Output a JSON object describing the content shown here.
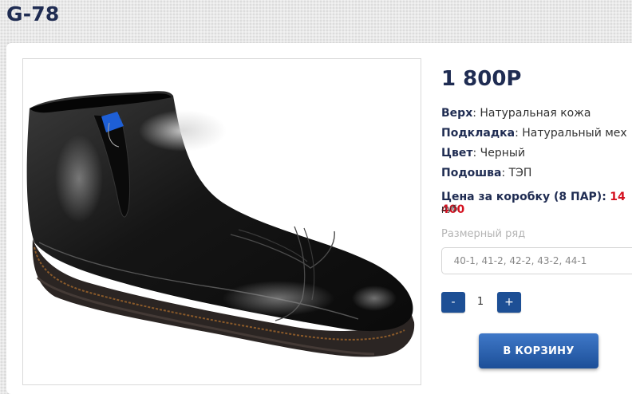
{
  "product": {
    "title": "G-78",
    "price": "1 800Р",
    "image_alt": "black-leather-ankle-boot",
    "specs": [
      {
        "key": "Верх",
        "value": ": Натуральная кожа"
      },
      {
        "key": "Подкладка",
        "value": ": Натуральный мех"
      },
      {
        "key": "Цвет",
        "value": ": Черный"
      },
      {
        "key": "Подошва",
        "value": ": ТЭП"
      }
    ],
    "box_price": {
      "label": "Цена за коробку (8 ПАР):",
      "value": "14 400",
      "unit": "руб"
    }
  },
  "sizes": {
    "label": "Размерный ряд",
    "selected": "40-1, 41-2, 42-2, 43-2, 44-1"
  },
  "quantity": {
    "minus_label": "-",
    "value": "1",
    "plus_label": "+"
  },
  "cart": {
    "button_label": "В КОРЗИНУ"
  },
  "colors": {
    "title": "#1f2c52",
    "accent_button": "#1d4f95",
    "box_price": "#d4101f"
  }
}
